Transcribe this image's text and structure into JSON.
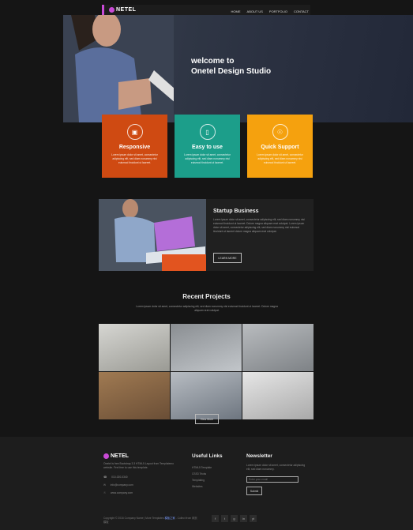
{
  "nav": {
    "logo": "NETEL",
    "items": [
      "HOME",
      "ABOUT US",
      "PORTFOLIO",
      "CONTACT"
    ]
  },
  "hero": {
    "title_line1": "welcome to",
    "title_line2": "Onetel Design Studio"
  },
  "features": [
    {
      "title": "Responsive",
      "icon": "laptop-icon",
      "color": "#cf4a12",
      "text": "Lorem ipsum dolor sit amet, consectetur adipiscing elit, sed diam nonummy nisi euismod tincidunt ut laoreet."
    },
    {
      "title": "Easy to use",
      "icon": "phone-icon",
      "color": "#1c9e8a",
      "text": "Lorem ipsum dolor sit amet, consectetur adipiscing elit, sed diam nonummy nisi euismod tincidunt ut laoreet."
    },
    {
      "title": "Quick Support",
      "icon": "support-icon",
      "color": "#f5a10e",
      "text": "Lorem ipsum dolor sit amet, consectetur adipiscing elit, sed diam nonummy nisi euismod tincidunt ut laoreet."
    }
  ],
  "startup": {
    "title": "Startup Business",
    "text": "Lorem ipsum dolor sit amet, consectetur adipiscing elit, sed diam nonummy nisi euismod tincidunt ut laoreet. Dolore magna aliquam erat volutpat. Lorem ipsum dolor sit amet, consectetur adipiscing elit, sed diam nonummy nisi euismod tincidunt ut laoreet dolore magna aliquam erat volutpat.",
    "button": "LEARN MORE"
  },
  "recent": {
    "title": "Recent Projects",
    "text": "Lorem ipsum dolor sit amet, consectetur adipiscing elit, sed diam nonummy nisi euismod tincidunt ut laoreet. Dolore magna aliquam erat volutpat.",
    "button": "View More"
  },
  "footer": {
    "logo": "NETEL",
    "about": "Onetel is free Bootstrap 3.3 HTML5 Layout from Templatemo website. Feel free to use this template.",
    "phone": "010-020-0340",
    "email": "info@company.com",
    "web": "www.company.com",
    "links_title": "Useful Links",
    "links": [
      "HTML5 Template",
      "CSS3 Tricks",
      "Templating",
      "Websites"
    ],
    "newsletter_title": "Newsletter",
    "newsletter_text": "Lorem ipsum dolor sit amet, consectetur adipiscing elit, sed diam nonummy.",
    "newsletter_placeholder": "Enter your email",
    "newsletter_button": "Submit",
    "copyright": "Copyright © 2016 Company Name | More Templates",
    "copyright_link": "模板之家",
    "copyright_tail": " - Collect from 网页模板",
    "social": [
      "f",
      "t",
      "g",
      "in",
      "yt"
    ]
  }
}
